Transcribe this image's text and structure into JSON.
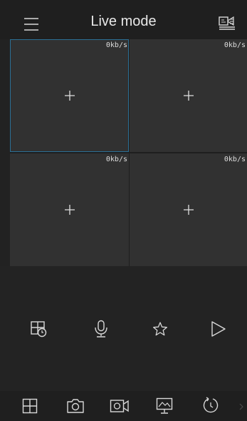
{
  "header": {
    "title": "Live mode",
    "menu_icon": "hamburger-menu-icon",
    "camera_list_icon": "camera-list-icon"
  },
  "tiles": [
    {
      "rate": "0kb/s",
      "selected": true,
      "icon": "add-icon"
    },
    {
      "rate": "0kb/s",
      "selected": false,
      "icon": "add-icon"
    },
    {
      "rate": "0kb/s",
      "selected": false,
      "icon": "add-icon"
    },
    {
      "rate": "0kb/s",
      "selected": false,
      "icon": "add-icon"
    }
  ],
  "controls": {
    "icons": [
      "playback-grid-icon",
      "microphone-icon",
      "favorite-star-icon",
      "play-icon"
    ]
  },
  "bottom_bar": {
    "icons": [
      "split-screen-icon",
      "snapshot-camera-icon",
      "record-video-icon",
      "monitor-display-icon",
      "rotate-refresh-icon"
    ]
  },
  "colors": {
    "background": "#222222",
    "tile": "#313131",
    "selected_border": "#2b6f95",
    "icon": "#d8d8d8"
  }
}
